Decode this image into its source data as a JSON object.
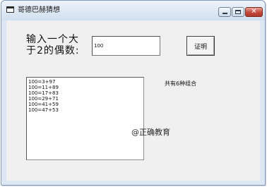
{
  "window": {
    "title": "哥德巴赫猜想",
    "icon": "window-app-icon",
    "controls": {
      "minimize_icon": "minimize-icon",
      "maximize_icon": "maximize-icon",
      "close_icon": "close-icon",
      "close_glyph": "✕"
    }
  },
  "form": {
    "prompt_label": "输入一个大于2的偶数:",
    "input_value": "100",
    "prove_button_label": "证明",
    "results": [
      "100=3+97",
      "100=11+89",
      "100=17+83",
      "100=29+71",
      "100=41+59",
      "100=47+53"
    ],
    "count_label": "共有6种组合"
  },
  "watermark": "@正确教育",
  "colors": {
    "client_background": "#f0f0f0",
    "frame_background": "#dde7f3",
    "close_button": "#c1473a"
  }
}
